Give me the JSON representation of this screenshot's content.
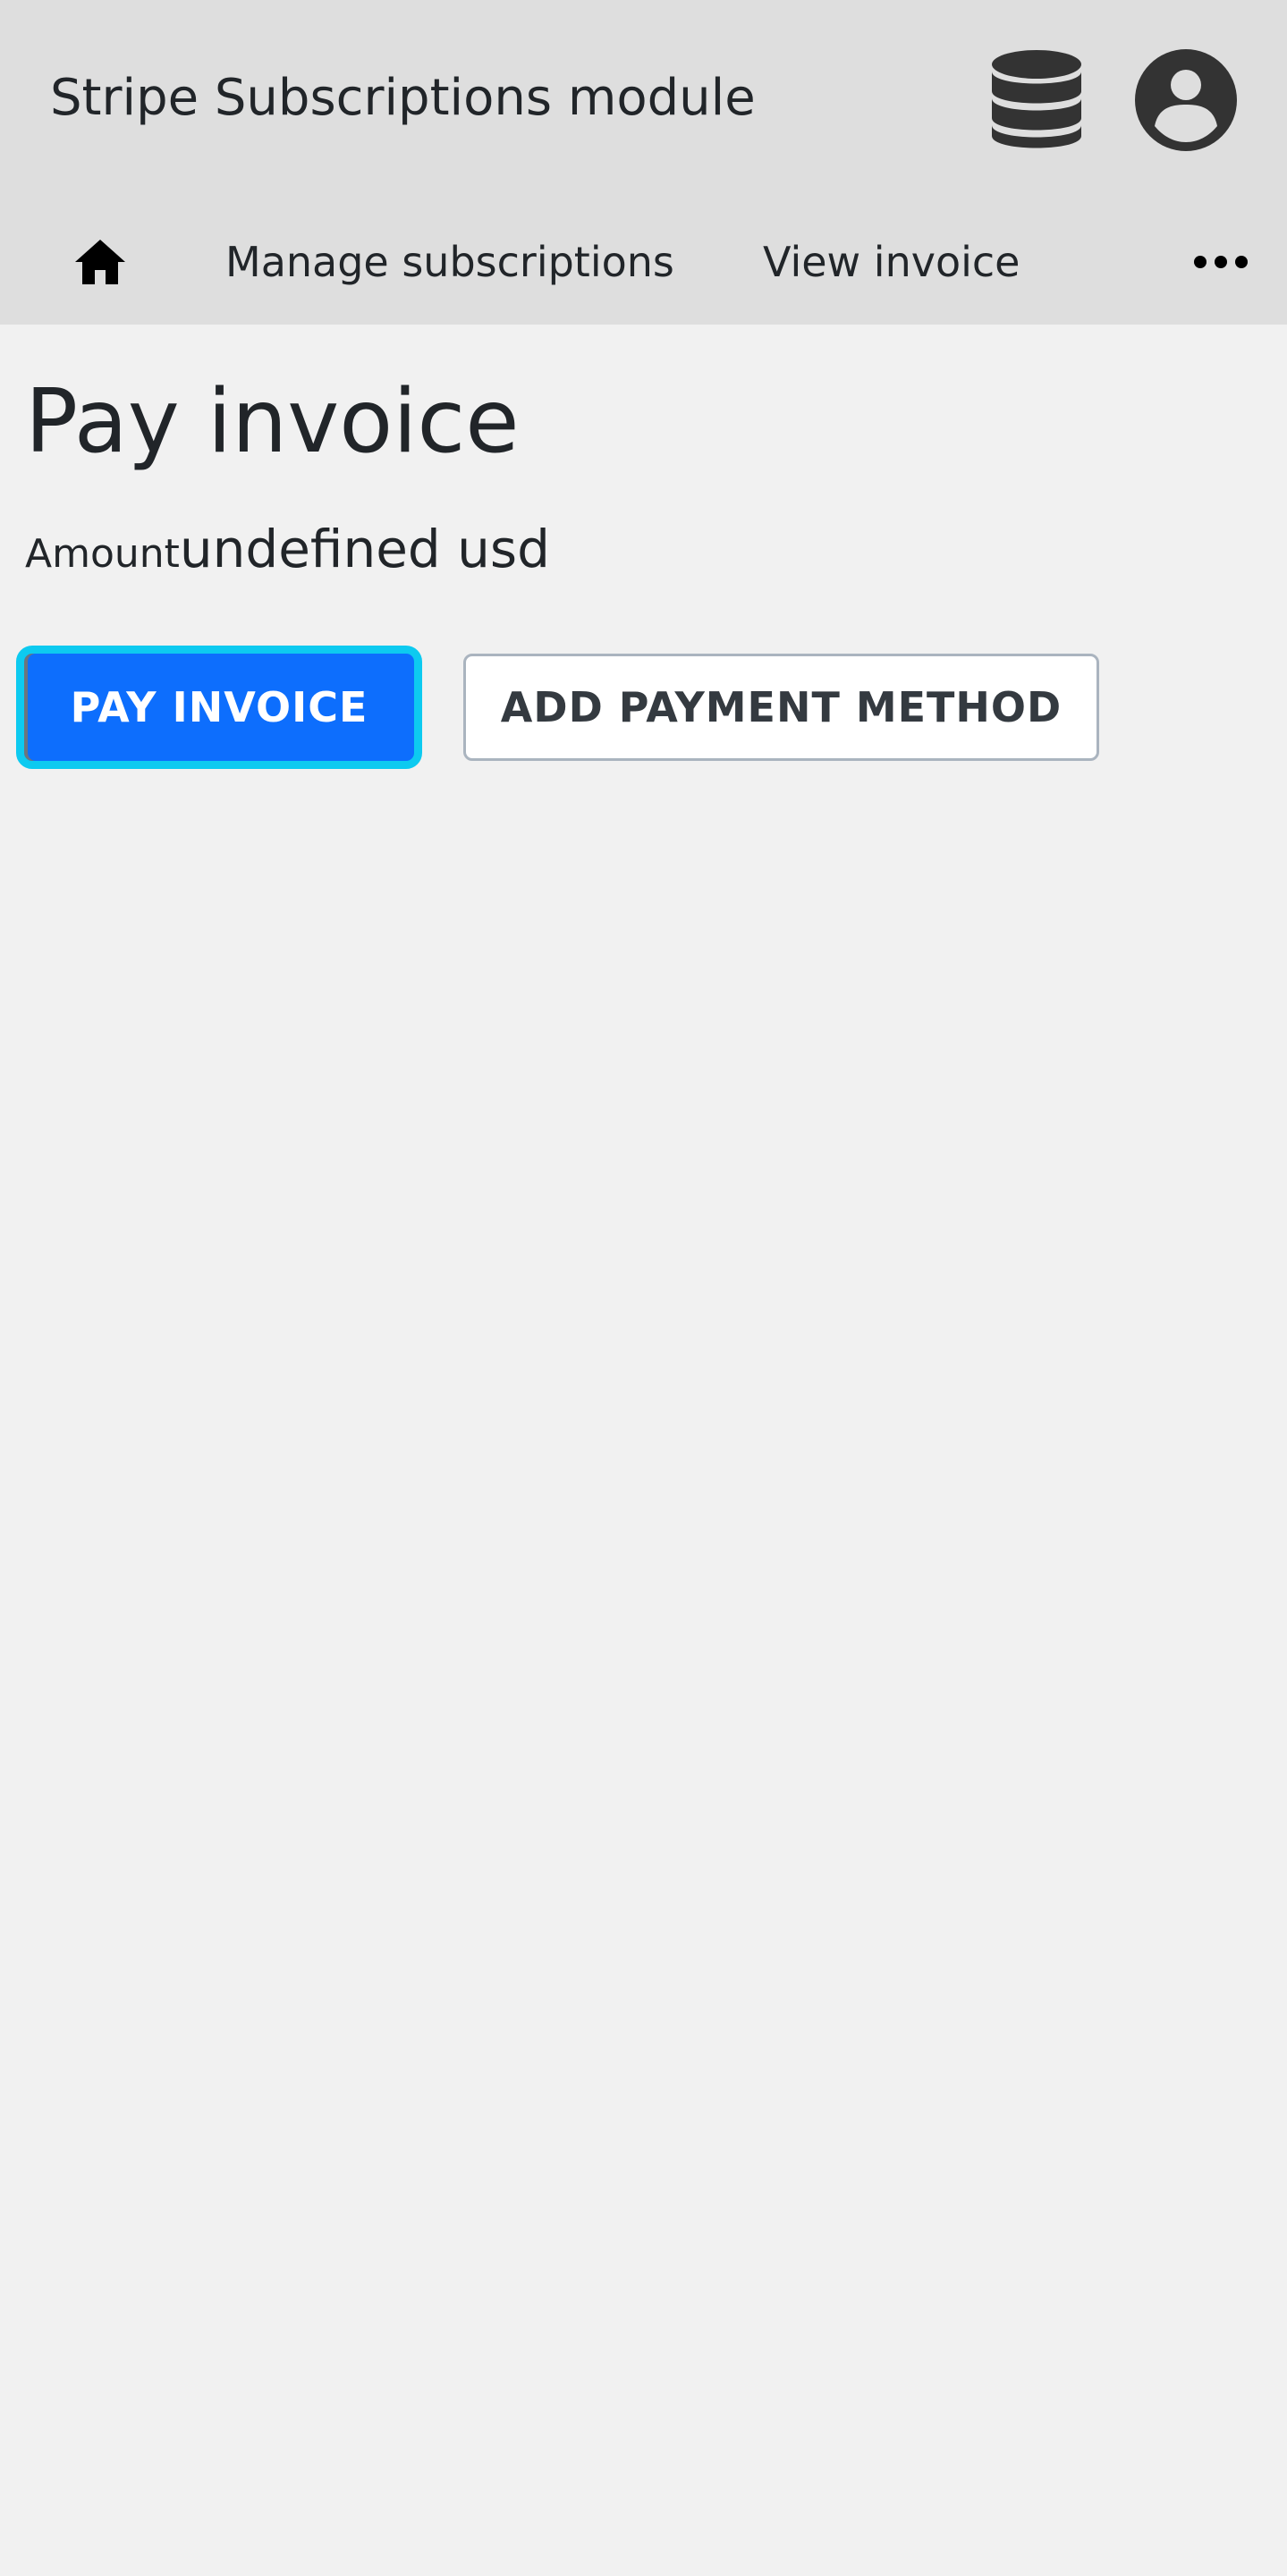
{
  "header": {
    "app_title": "Stripe Subscriptions module",
    "database_icon": "database-icon",
    "account_icon": "account-circle-icon"
  },
  "nav": {
    "home_icon": "home-icon",
    "items": [
      {
        "label": "Manage subscriptions"
      },
      {
        "label": "View invoice"
      }
    ],
    "more_icon": "more-horizontal-icon"
  },
  "main": {
    "title": "Pay invoice",
    "amount_label": "Amount",
    "amount_value": "undefined usd",
    "pay_button_label": "PAY INVOICE",
    "add_payment_button_label": "ADD PAYMENT METHOD"
  },
  "colors": {
    "bar_background": "#dedede",
    "page_background": "#f1f1f1",
    "primary": "#0d6efd",
    "focus_ring": "#0dcaf0",
    "icon_dark": "#333333"
  }
}
